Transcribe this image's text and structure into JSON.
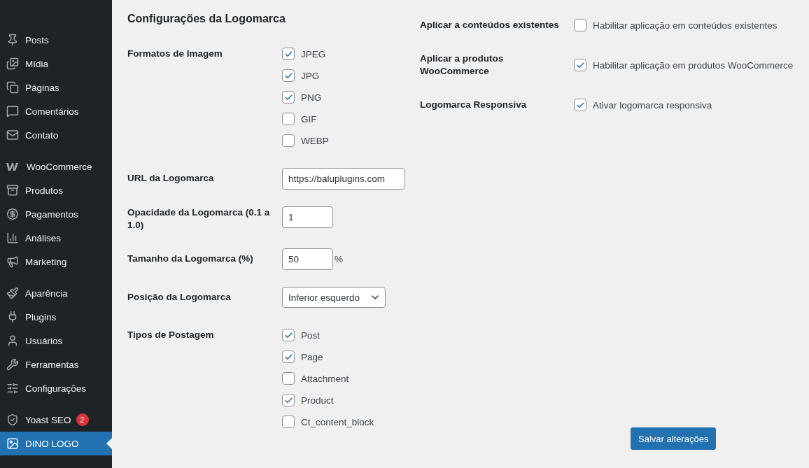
{
  "sidebar": {
    "groups": [
      {
        "items": [
          {
            "label": "Posts",
            "selected": false
          },
          {
            "label": "Mídia",
            "selected": false
          },
          {
            "label": "Páginas",
            "selected": false
          },
          {
            "label": "Comentários",
            "selected": false
          },
          {
            "label": "Contato",
            "selected": false
          }
        ]
      },
      {
        "items": [
          {
            "label": "WooCommerce",
            "selected": false
          },
          {
            "label": "Produtos",
            "selected": false
          },
          {
            "label": "Pagamentos",
            "selected": false
          },
          {
            "label": "Análises",
            "selected": false
          },
          {
            "label": "Marketing",
            "selected": false
          }
        ]
      },
      {
        "items": [
          {
            "label": "Aparência",
            "selected": false
          },
          {
            "label": "Plugins",
            "selected": false
          },
          {
            "label": "Usuários",
            "selected": false
          },
          {
            "label": "Ferramentas",
            "selected": false
          },
          {
            "label": "Configurações",
            "selected": false
          }
        ]
      },
      {
        "items": [
          {
            "label": "Yoast SEO",
            "selected": false,
            "badge": "2"
          },
          {
            "label": "DINO LOGO",
            "selected": true
          }
        ]
      }
    ]
  },
  "title": "Configurações da Logomarca",
  "left_fields": [
    {
      "kind": "checkboxes",
      "label": "Formatos de Imagem",
      "options": [
        {
          "label": "JPEG",
          "checked": true
        },
        {
          "label": "JPG",
          "checked": true
        },
        {
          "label": "PNG",
          "checked": true
        },
        {
          "label": "GIF",
          "checked": false
        },
        {
          "label": "WEBP",
          "checked": false
        }
      ]
    },
    {
      "kind": "text",
      "label": "URL da Logomarca",
      "value": "https://baluplugins.com"
    },
    {
      "kind": "number",
      "label": "Opacidade da Logomarca (0.1 a 1.0)",
      "value": "1"
    },
    {
      "kind": "number",
      "label": "Tamanho da Logomarca (%)",
      "value": "50",
      "unit": "%"
    },
    {
      "kind": "select",
      "label": "Posição da Logomarca",
      "value": "Inferior esquerdo"
    },
    {
      "kind": "checkboxes",
      "label": "Tipos de Postagem",
      "options": [
        {
          "label": "Post",
          "checked": true
        },
        {
          "label": "Page",
          "checked": true
        },
        {
          "label": "Attachment",
          "checked": false
        },
        {
          "label": "Product",
          "checked": true
        },
        {
          "label": "Ct_content_block",
          "checked": false
        }
      ]
    }
  ],
  "right_fields": [
    {
      "label": "Aplicar a conteúdos existentes",
      "option": "Habilitar aplicação em conteúdos existentes",
      "checked": false
    },
    {
      "label": "Aplicar a produtos WooCommerce",
      "option": "Habilitar aplicação em produtos WooCommerce",
      "checked": true
    },
    {
      "label": "Logomarca Responsiva",
      "option": "Ativar logomarca responsiva",
      "checked": true
    }
  ],
  "save_button": "Salvar alterações"
}
